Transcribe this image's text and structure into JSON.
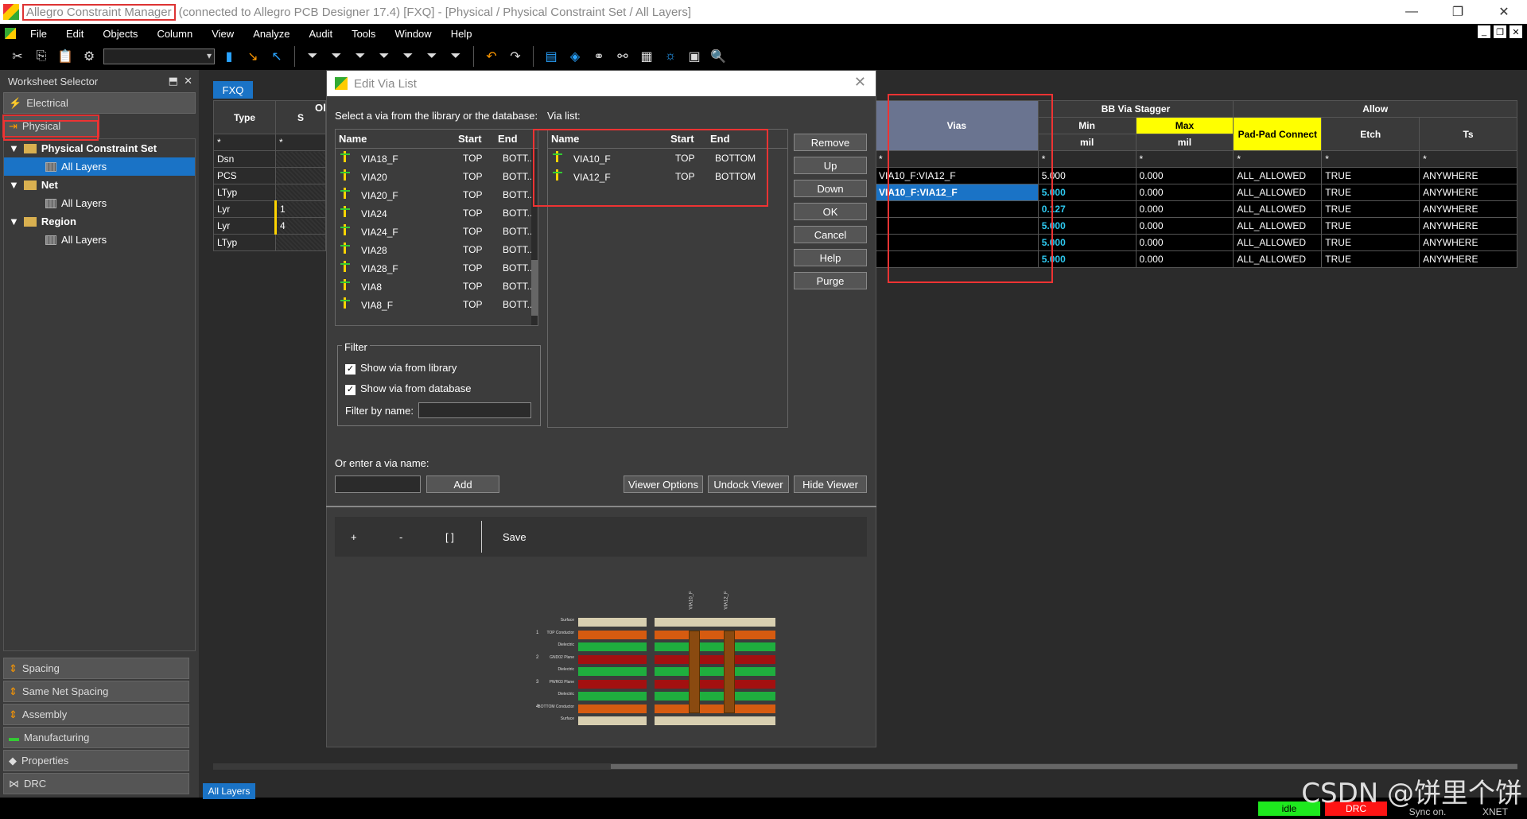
{
  "window": {
    "app_title": "Allegro Constraint Manager",
    "title_rest": "(connected to Allegro PCB Designer 17.4) [FXQ] - [Physical / Physical Constraint Set / All Layers]"
  },
  "menu": [
    "File",
    "Edit",
    "Objects",
    "Column",
    "View",
    "Analyze",
    "Audit",
    "Tools",
    "Window",
    "Help"
  ],
  "left": {
    "header": "Worksheet Selector",
    "electrical": "Electrical",
    "physical": "Physical",
    "tree": {
      "pcs": "Physical Constraint Set",
      "pcs_all": "All Layers",
      "net": "Net",
      "net_all": "All Layers",
      "region": "Region",
      "region_all": "All Layers"
    },
    "bottom": [
      "Spacing",
      "Same Net Spacing",
      "Assembly",
      "Manufacturing",
      "Properties",
      "DRC"
    ]
  },
  "tab": "FXQ",
  "grid": {
    "col_obj": "Ol",
    "col_type": "Type",
    "col_s": "S",
    "rows": [
      {
        "type": "*",
        "s": "*"
      },
      {
        "type": "Dsn",
        "s": ""
      },
      {
        "type": "PCS",
        "s": ""
      },
      {
        "type": "LTyp",
        "s": ""
      },
      {
        "type": "Lyr",
        "s": "1"
      },
      {
        "type": "Lyr",
        "s": "4"
      },
      {
        "type": "LTyp",
        "s": ""
      }
    ],
    "vias_header": "Vias",
    "bb_header": "BB Via Stagger",
    "allow_header": "Allow",
    "min": "Min",
    "max": "Max",
    "mil1": "mil",
    "mil2": "mil",
    "padpad": "Pad-Pad Connect",
    "etch": "Etch",
    "ts": "Ts",
    "right_rows": [
      {
        "vias": "*",
        "min": "*",
        "max": "*",
        "pp": "*",
        "etch": "*",
        "ts": "*"
      },
      {
        "vias": "VIA10_F:VIA12_F",
        "min": "5.000",
        "max": "0.000",
        "pp": "ALL_ALLOWED",
        "etch": "TRUE",
        "ts": "ANYWHERE"
      },
      {
        "vias": "VIA10_F:VIA12_F",
        "min": "5.000",
        "max": "0.000",
        "pp": "ALL_ALLOWED",
        "etch": "TRUE",
        "ts": "ANYWHERE"
      },
      {
        "vias": "",
        "min": "0.127",
        "max": "0.000",
        "pp": "ALL_ALLOWED",
        "etch": "TRUE",
        "ts": "ANYWHERE"
      },
      {
        "vias": "",
        "min": "5.000",
        "max": "0.000",
        "pp": "ALL_ALLOWED",
        "etch": "TRUE",
        "ts": "ANYWHERE"
      },
      {
        "vias": "",
        "min": "5.000",
        "max": "0.000",
        "pp": "ALL_ALLOWED",
        "etch": "TRUE",
        "ts": "ANYWHERE"
      },
      {
        "vias": "",
        "min": "5.000",
        "max": "0.000",
        "pp": "ALL_ALLOWED",
        "etch": "TRUE",
        "ts": "ANYWHERE"
      }
    ]
  },
  "dialog": {
    "title": "Edit Via List",
    "select_label": "Select a via from the library or the database:",
    "vialist_label": "Via list:",
    "col_name": "Name",
    "col_start": "Start",
    "col_end": "End",
    "library": [
      {
        "name": "VIA18_F",
        "start": "TOP",
        "end": "BOTT..."
      },
      {
        "name": "VIA20",
        "start": "TOP",
        "end": "BOTT..."
      },
      {
        "name": "VIA20_F",
        "start": "TOP",
        "end": "BOTT..."
      },
      {
        "name": "VIA24",
        "start": "TOP",
        "end": "BOTT..."
      },
      {
        "name": "VIA24_F",
        "start": "TOP",
        "end": "BOTT..."
      },
      {
        "name": "VIA28",
        "start": "TOP",
        "end": "BOTT..."
      },
      {
        "name": "VIA28_F",
        "start": "TOP",
        "end": "BOTT..."
      },
      {
        "name": "VIA8",
        "start": "TOP",
        "end": "BOTT..."
      },
      {
        "name": "VIA8_F",
        "start": "TOP",
        "end": "BOTT..."
      }
    ],
    "vialist": [
      {
        "name": "VIA10_F",
        "start": "TOP",
        "end": "BOTTOM"
      },
      {
        "name": "VIA12_F",
        "start": "TOP",
        "end": "BOTTOM"
      }
    ],
    "buttons": {
      "remove": "Remove",
      "up": "Up",
      "down": "Down",
      "ok": "OK",
      "cancel": "Cancel",
      "help": "Help",
      "purge": "Purge"
    },
    "filter": {
      "title": "Filter",
      "lib": "Show via from library",
      "db": "Show via from database",
      "byname": "Filter by name:"
    },
    "enter_label": "Or enter a via name:",
    "add": "Add",
    "viewer_options": "Viewer Options",
    "undock": "Undock Viewer",
    "hide": "Hide Viewer",
    "viewer_tb": {
      "plus": "+",
      "minus": "-",
      "brackets": "[ ]",
      "save": "Save"
    },
    "stack_labels": [
      "Surface",
      "TOP Conductor",
      "Dielectric",
      "GND02 Plane",
      "Dielectric",
      "PWR03 Plane",
      "Dielectric",
      "BOTTOM Conductor",
      "Surface"
    ],
    "layer_nums": [
      "1",
      "2",
      "3",
      "4"
    ],
    "via_names": [
      "VIA10_F",
      "VIA12_F"
    ]
  },
  "status": {
    "tab": "All Layers",
    "idle": "idle",
    "drc": "DRC",
    "sync": "Sync on.",
    "xnet": "XNET"
  },
  "watermark": "CSDN @饼里个饼"
}
